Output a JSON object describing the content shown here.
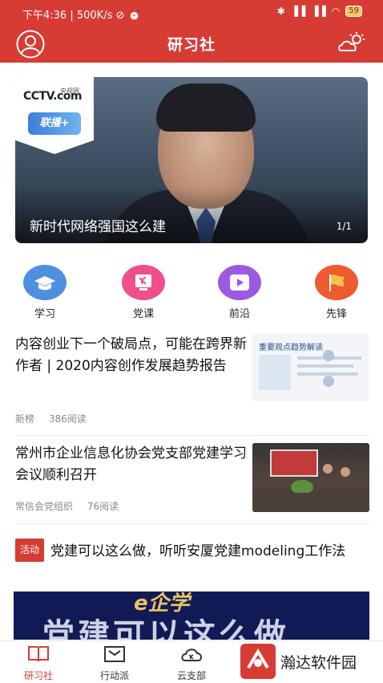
{
  "status_bar": {
    "time": "下午4:36",
    "speed": "500K/s",
    "battery": "59"
  },
  "header": {
    "title": "研习社"
  },
  "banner": {
    "caption": "新时代网络强国这么建",
    "pager": "1/1",
    "logo_text": "CCTV.com",
    "logo_sub": "央视网",
    "program_text": "联播+"
  },
  "quick_nav": [
    {
      "label": "学习",
      "icon": "graduation-cap-icon",
      "color": "#4e8fe0"
    },
    {
      "label": "党课",
      "icon": "party-emblem-icon",
      "color": "#ef4f8d"
    },
    {
      "label": "前沿",
      "icon": "video-play-icon",
      "color": "#9b5ae0"
    },
    {
      "label": "先锋",
      "icon": "flag-icon",
      "color": "#ef5a2e"
    }
  ],
  "articles": [
    {
      "title": "内容创业下一个破局点，可能在跨界新作者 | 2020内容创作发展趋势报告",
      "source": "新榜",
      "reads": "386阅读",
      "thumb_label": "重要观点趋势解读"
    },
    {
      "title": "常州市企业信息化协会党支部党建学习会议顺利召开",
      "source": "常信会党组织",
      "reads": "76阅读"
    },
    {
      "tag": "活动",
      "title": "党建可以这么做，听听安厦党建modeling工作法"
    }
  ],
  "promo": {
    "top_text": "e企学",
    "big_text": "党建可以这么做"
  },
  "tabs": [
    {
      "label": "研习社",
      "icon": "book-icon",
      "active": true
    },
    {
      "label": "行动派",
      "icon": "action-icon",
      "active": false
    },
    {
      "label": "云支部",
      "icon": "cloud-party-icon",
      "active": false
    }
  ],
  "watermark": {
    "text": "瀚达软件园"
  },
  "colors": {
    "brand": "#d63b34"
  }
}
